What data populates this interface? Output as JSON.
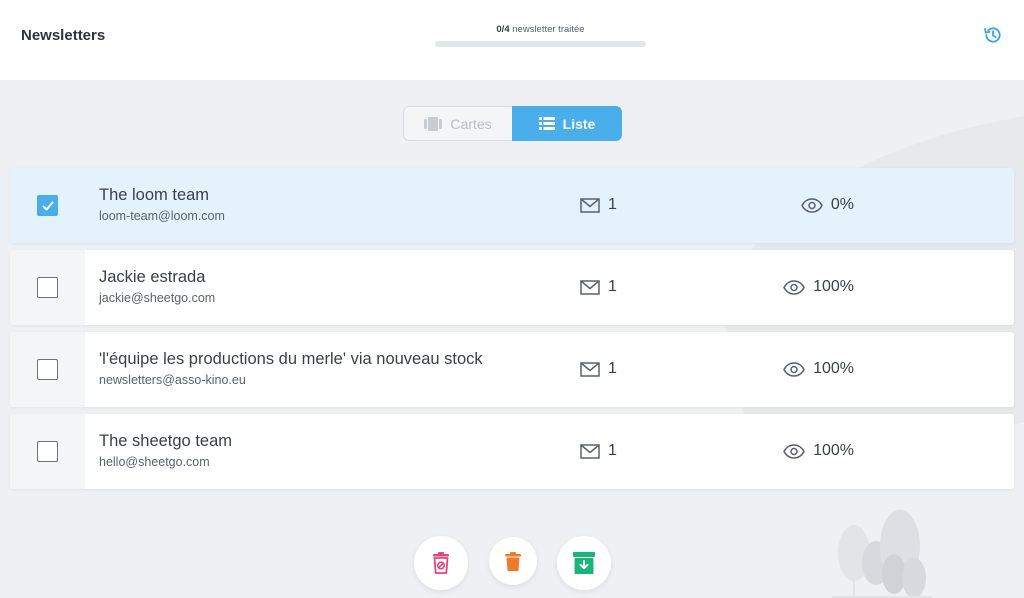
{
  "header": {
    "title": "Newsletters",
    "progress": {
      "count": "0/4",
      "label": "newsletter traitée",
      "fraction": 0
    }
  },
  "view_toggle": {
    "cards_label": "Cartes",
    "list_label": "Liste",
    "active": "list"
  },
  "newsletters": [
    {
      "name": "The loom team",
      "email": "loom-team@loom.com",
      "count": "1",
      "open_rate": "0%",
      "selected": true
    },
    {
      "name": "Jackie estrada",
      "email": "jackie@sheetgo.com",
      "count": "1",
      "open_rate": "100%",
      "selected": false
    },
    {
      "name": "'l'équipe les productions du merle' via nouveau stock",
      "email": "newsletters@asso-kino.eu",
      "count": "1",
      "open_rate": "100%",
      "selected": false
    },
    {
      "name": "The sheetgo team",
      "email": "hello@sheetgo.com",
      "count": "1",
      "open_rate": "100%",
      "selected": false
    }
  ],
  "actions": [
    {
      "icon": "unsubscribe-icon",
      "color": "#e8457a"
    },
    {
      "icon": "trash-icon",
      "color": "#f07a2a"
    },
    {
      "icon": "archive-icon",
      "color": "#19b67a"
    }
  ],
  "colors": {
    "accent": "#4aaeea",
    "selected_row": "#e4f2fc",
    "background": "#eef0f3"
  }
}
